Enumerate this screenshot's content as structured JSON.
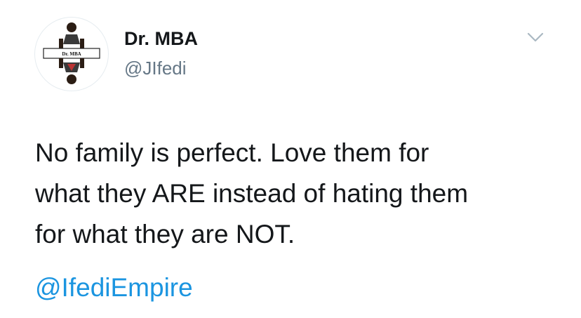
{
  "author": {
    "display_name": "Dr. MBA",
    "handle": "@JIfedi",
    "avatar_label": "Dr. MBA"
  },
  "tweet": {
    "lines": [
      "No family is perfect. Love them for",
      "what they ARE instead of hating them",
      "for what they are NOT."
    ],
    "mention": "@IfediEmpire"
  },
  "icons": {
    "menu": "chevron-down-icon"
  },
  "colors": {
    "name": "#14171a",
    "handle": "#657786",
    "link": "#1b95e0",
    "chevron": "#aab8c2"
  }
}
